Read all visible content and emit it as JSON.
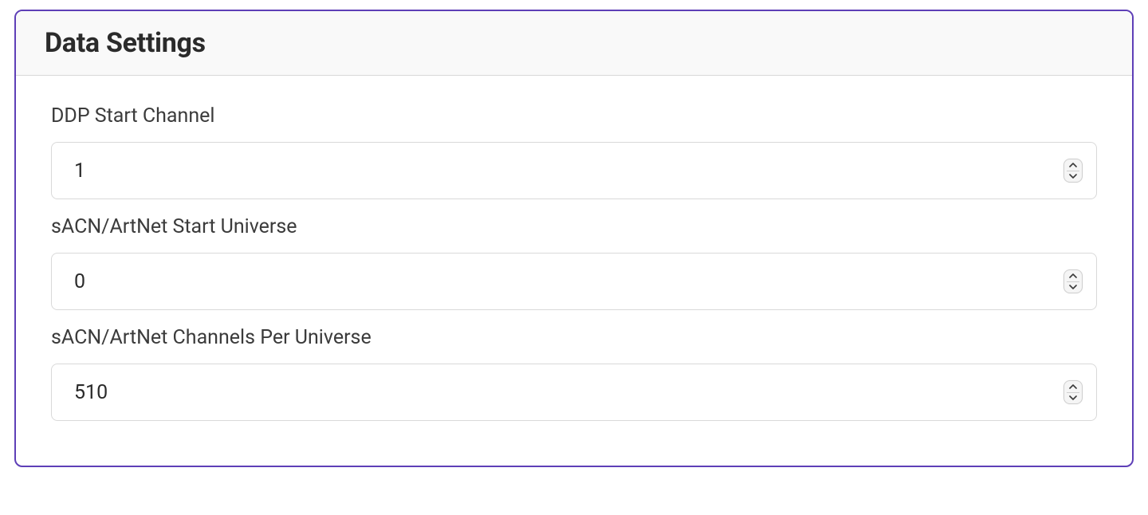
{
  "panel": {
    "title": "Data Settings",
    "fields": {
      "ddp_start_channel": {
        "label": "DDP Start Channel",
        "value": "1"
      },
      "sacn_start_universe": {
        "label": "sACN/ArtNet Start Universe",
        "value": "0"
      },
      "sacn_channels_per_universe": {
        "label": "sACN/ArtNet Channels Per Universe",
        "value": "510"
      }
    }
  }
}
